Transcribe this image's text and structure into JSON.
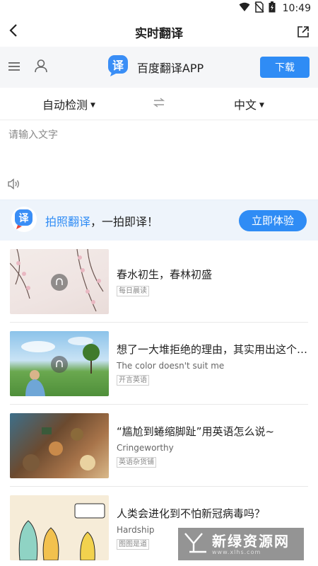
{
  "status_bar": {
    "time": "10:49"
  },
  "title_bar": {
    "title": "实时翻译"
  },
  "app_banner": {
    "app_name": "百度翻译APP",
    "download_label": "下载",
    "logo_char": "译"
  },
  "language_bar": {
    "source": "自动检测",
    "target": "中文"
  },
  "input": {
    "placeholder": "请输入文字",
    "value": ""
  },
  "photo_promo": {
    "logo_char": "译",
    "highlight": "拍照翻译",
    "rest": "，一拍即译！",
    "button_label": "立即体验"
  },
  "feed": [
    {
      "title": "春水初生，春林初盛",
      "subtitle": "",
      "tag": "每日晨读"
    },
    {
      "title": "想了一大堆拒绝的理由，其实用出这个英语",
      "subtitle": "The color doesn't suit me",
      "tag": "开言英语"
    },
    {
      "title": "“尴尬到蜷缩脚趾”用英语怎么说~",
      "subtitle": "Cringeworthy",
      "tag": "英语杂货铺"
    },
    {
      "title": "人类会进化到不怕新冠病毒吗？",
      "subtitle": "Hardship",
      "tag": "图图是道"
    }
  ],
  "watermark": {
    "text": "新绿资源网",
    "url": "www.xlhs.com"
  },
  "colors": {
    "accent": "#2f8cf5",
    "banner_bg": "#f5f6f8",
    "promo_bg": "#eef4fb"
  }
}
